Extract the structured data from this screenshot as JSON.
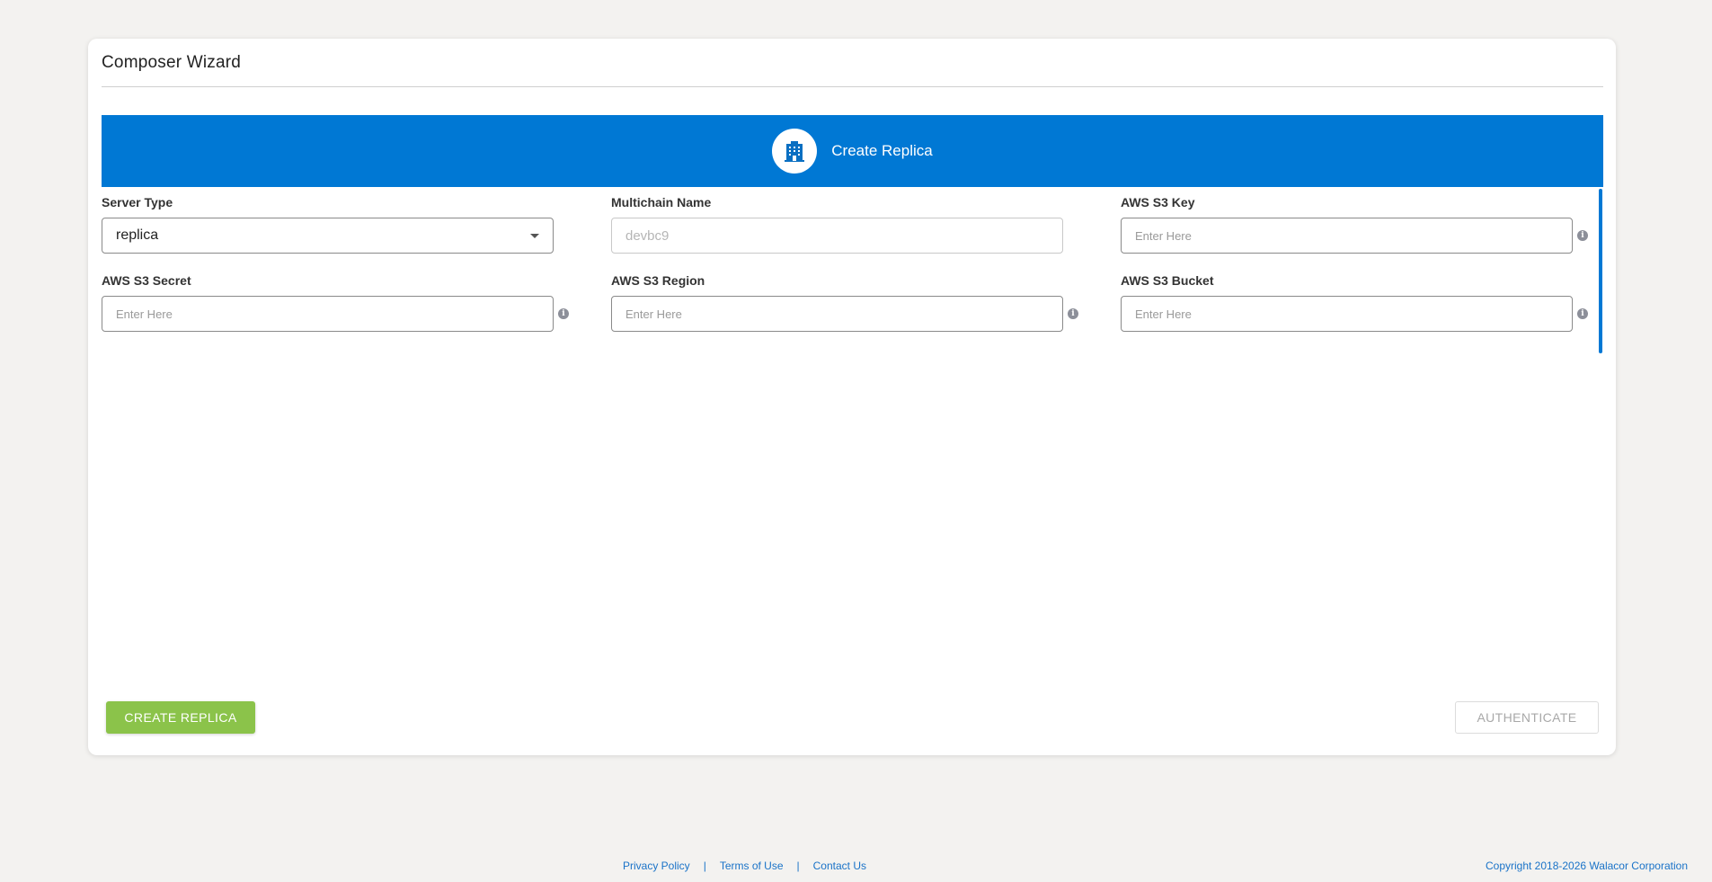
{
  "card": {
    "title": "Composer Wizard"
  },
  "banner": {
    "label": "Create Replica",
    "icon": "building-icon",
    "color": "#0078d4"
  },
  "form": {
    "server_type": {
      "label": "Server Type",
      "value": "replica"
    },
    "multichain_name": {
      "label": "Multichain Name",
      "value": "devbc9"
    },
    "aws_s3_key": {
      "label": "AWS S3 Key",
      "placeholder": "Enter Here"
    },
    "aws_s3_secret": {
      "label": "AWS S3 Secret",
      "placeholder": "Enter Here"
    },
    "aws_s3_region": {
      "label": "AWS S3 Region",
      "placeholder": "Enter Here"
    },
    "aws_s3_bucket": {
      "label": "AWS S3 Bucket",
      "placeholder": "Enter Here"
    }
  },
  "actions": {
    "create_replica": "CREATE REPLICA",
    "authenticate": "AUTHENTICATE",
    "primary_color": "#8bc34a"
  },
  "footer": {
    "privacy": "Privacy Policy",
    "terms": "Terms of Use",
    "contact": "Contact Us",
    "separator": "|",
    "copyright": "Copyright 2018-2026 Walacor Corporation"
  }
}
